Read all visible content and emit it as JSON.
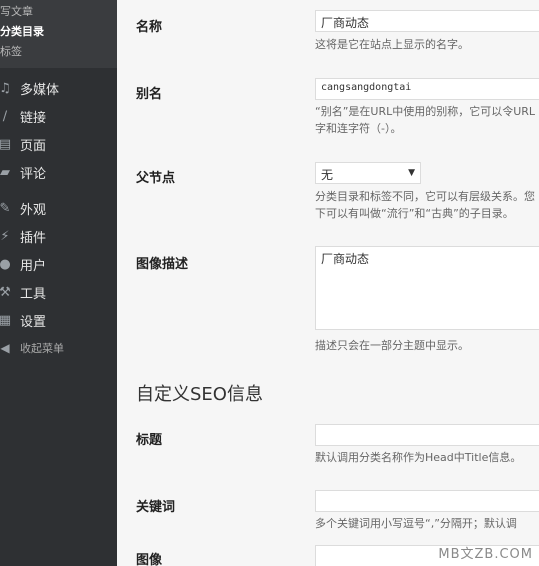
{
  "sidebar": {
    "sub_items": [
      {
        "label": "写文章"
      },
      {
        "label": "分类目录"
      },
      {
        "label": "标签"
      }
    ],
    "menu": [
      {
        "label": "多媒体",
        "icon": "media-icon"
      },
      {
        "label": "链接",
        "icon": "link-icon"
      },
      {
        "label": "页面",
        "icon": "page-icon"
      },
      {
        "label": "评论",
        "icon": "comment-icon"
      },
      {
        "label": "外观",
        "icon": "appearance-icon"
      },
      {
        "label": "插件",
        "icon": "plugin-icon"
      },
      {
        "label": "用户",
        "icon": "user-icon"
      },
      {
        "label": "工具",
        "icon": "tools-icon"
      },
      {
        "label": "设置",
        "icon": "settings-icon"
      },
      {
        "label": "收起菜单",
        "icon": "collapse-icon"
      }
    ]
  },
  "form": {
    "name_label": "名称",
    "name_value": "厂商动态",
    "name_desc": "这将是它在站点上显示的名字。",
    "slug_label": "别名",
    "slug_value": "cangsangdongtai",
    "slug_desc_1": "“别名”是在URL中使用的别称，它可以令URL",
    "slug_desc_2": "字和连字符（-）。",
    "parent_label": "父节点",
    "parent_value": "无",
    "parent_desc_1": "分类目录和标签不同，它可以有层级关系。您",
    "parent_desc_2": "下可以有叫做“流行”和“古典”的子目录。",
    "image_desc_label": "图像描述",
    "image_desc_value": "厂商动态",
    "image_desc_desc": "描述只会在一部分主题中显示。",
    "seo_title": "自定义SEO信息",
    "title_label": "标题",
    "title_value": "",
    "title_desc": "默认调用分类名称作为Head中Title信息。",
    "keywords_label": "关键词",
    "keywords_value": "",
    "keywords_desc": "多个关键词用小写逗号“,”分隔开；默认调",
    "image_label": "图像",
    "image_value": ""
  },
  "watermark": "MB文ZB.COM"
}
